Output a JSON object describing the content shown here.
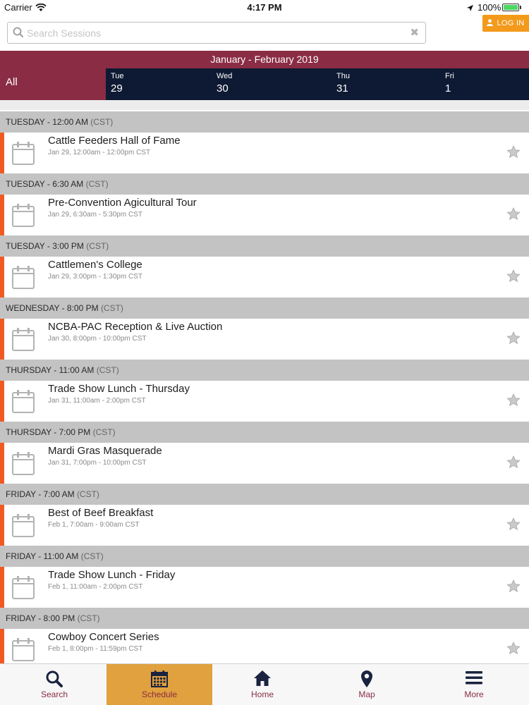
{
  "status_bar": {
    "carrier": "Carrier",
    "time": "4:17 PM",
    "battery": "100%"
  },
  "search": {
    "placeholder": "Search Sessions",
    "clear_glyph": "✖"
  },
  "login": {
    "label": "LOG IN"
  },
  "calendar": {
    "month_range": "January - February 2019",
    "all_label": "All",
    "days": [
      {
        "dow": "Tue",
        "num": "29"
      },
      {
        "dow": "Wed",
        "num": "30"
      },
      {
        "dow": "Thu",
        "num": "31"
      },
      {
        "dow": "Fri",
        "num": "1"
      }
    ]
  },
  "sections": [
    {
      "heading": "TUESDAY - 12:00 AM",
      "tz": "(CST)",
      "title": "Cattle Feeders Hall of Fame",
      "time": "Jan 29, 12:00am - 12:00pm CST"
    },
    {
      "heading": "TUESDAY - 6:30 AM",
      "tz": "(CST)",
      "title": "Pre-Convention Agicultural Tour",
      "time": "Jan 29, 6:30am - 5:30pm CST"
    },
    {
      "heading": "TUESDAY - 3:00 PM",
      "tz": "(CST)",
      "title": "Cattlemen's College",
      "time": "Jan 29, 3:00pm - 1:30pm CST"
    },
    {
      "heading": "WEDNESDAY - 8:00 PM",
      "tz": "(CST)",
      "title": "NCBA-PAC Reception & Live Auction",
      "time": "Jan 30, 8:00pm - 10:00pm CST"
    },
    {
      "heading": "THURSDAY - 11:00 AM",
      "tz": "(CST)",
      "title": "Trade Show Lunch - Thursday",
      "time": "Jan 31, 11:00am - 2:00pm CST"
    },
    {
      "heading": "THURSDAY - 7:00 PM",
      "tz": "(CST)",
      "title": "Mardi Gras Masquerade",
      "time": "Jan 31, 7:00pm - 10:00pm CST"
    },
    {
      "heading": "FRIDAY - 7:00 AM",
      "tz": "(CST)",
      "title": "Best of Beef Breakfast",
      "time": "Feb 1, 7:00am - 9:00am CST"
    },
    {
      "heading": "FRIDAY - 11:00 AM",
      "tz": "(CST)",
      "title": "Trade Show Lunch - Friday",
      "time": "Feb 1, 11:00am - 2:00pm CST"
    },
    {
      "heading": "FRIDAY - 8:00 PM",
      "tz": "(CST)",
      "title": "Cowboy Concert Series",
      "time": "Feb 1, 8:00pm - 11:59pm CST"
    }
  ],
  "tabbar": [
    {
      "label": "Search",
      "icon": "search-icon"
    },
    {
      "label": "Schedule",
      "icon": "calendar-icon"
    },
    {
      "label": "Home",
      "icon": "home-icon"
    },
    {
      "label": "Map",
      "icon": "map-pin-icon"
    },
    {
      "label": "More",
      "icon": "menu-icon"
    }
  ],
  "colors": {
    "brand_maroon": "#8a2c44",
    "navy": "#0e1a33",
    "accent_orange": "#f39a1b",
    "item_stripe": "#f05a22",
    "active_tab": "#e0a13e"
  }
}
